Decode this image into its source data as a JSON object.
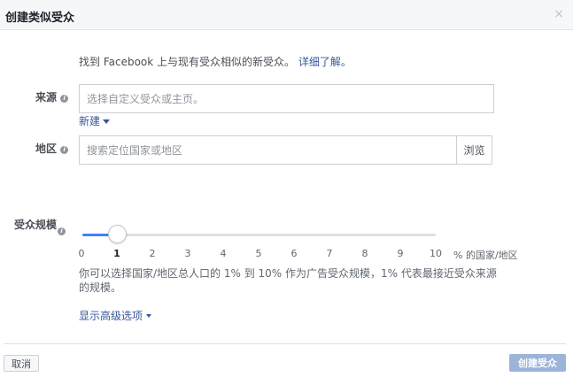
{
  "dialog": {
    "title": "创建类似受众",
    "close_glyph": "×"
  },
  "intro": {
    "text": "找到 Facebook 上与现有受众相似的新受众。",
    "link": "详细了解。"
  },
  "source": {
    "label": "来源",
    "placeholder": "选择自定义受众或主页。",
    "new_link": "新建"
  },
  "region": {
    "label": "地区",
    "placeholder": "搜索定位国家或地区",
    "browse_button": "浏览"
  },
  "audience_size": {
    "label": "受众规模",
    "selected_value": 1,
    "min": 0,
    "max": 10,
    "ticks": [
      "0",
      "1",
      "2",
      "3",
      "4",
      "5",
      "6",
      "7",
      "8",
      "9",
      "10"
    ],
    "unit": "% 的国家/地区",
    "hint": "你可以选择国家/地区总人口的 1% 到 10% 作为广告受众规模，1% 代表最接近受众来源的规模。"
  },
  "advanced_options": "显示高级选项",
  "footer": {
    "cancel_button": "取消",
    "create_button": "创建受众"
  },
  "colors": {
    "link": "#365899",
    "slider_fill": "#4080ff",
    "primary_disabled": "#9cb4d8"
  },
  "icons": {
    "info": "info-icon",
    "close": "close-icon",
    "dropdown": "caret-down-icon"
  }
}
